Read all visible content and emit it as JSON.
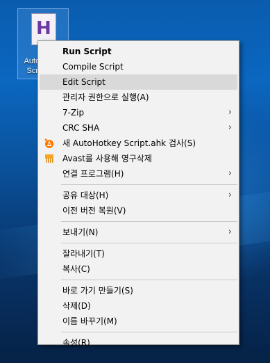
{
  "desktop": {
    "icon_label": "AutoHotkey Script.ahk",
    "icon_letter": "H"
  },
  "menu": {
    "run": "Run Script",
    "compile": "Compile Script",
    "edit": "Edit Script",
    "run_admin": "관리자 권한으로 실행(A)",
    "zip": "7-Zip",
    "crc": "CRC SHA",
    "scan": "새 AutoHotkey Script.ahk 검사(S)",
    "avast_shred": "Avast를 사용해 영구삭제",
    "open_with": "연결 프로그램(H)",
    "share": "공유 대상(H)",
    "restore": "이전 버전 복원(V)",
    "send_to": "보내기(N)",
    "cut": "잘라내기(T)",
    "copy": "복사(C)",
    "shortcut": "바로 가기 만들기(S)",
    "delete": "삭제(D)",
    "rename": "이름 바꾸기(M)",
    "properties": "속성(R)",
    "submenu_glyph": "›"
  },
  "colors": {
    "avast_orange": "#ff7800",
    "shredder_orange": "#f5a623",
    "highlight": "#d9d9d9"
  }
}
